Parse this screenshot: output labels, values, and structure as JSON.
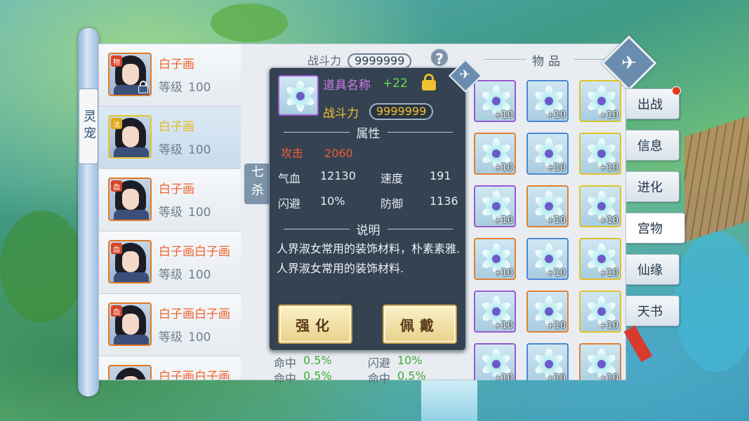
{
  "side_label": "灵宠",
  "pets": [
    {
      "type": "物",
      "name": "白子画",
      "level_label": "等级",
      "level": "100",
      "locked": true,
      "selected": false,
      "gold": false
    },
    {
      "type": "法",
      "name": "白子画",
      "level_label": "等级",
      "level": "100",
      "locked": false,
      "selected": true,
      "gold": true
    },
    {
      "type": "血",
      "name": "白子画",
      "level_label": "等级",
      "level": "100",
      "locked": false,
      "selected": false,
      "gold": false
    },
    {
      "type": "血",
      "name": "白子画白子画",
      "level_label": "等级",
      "level": "100",
      "locked": false,
      "selected": false,
      "gold": false
    },
    {
      "type": "血",
      "name": "白子画白子画",
      "level_label": "等级",
      "level": "100",
      "locked": false,
      "selected": false,
      "gold": false
    },
    {
      "type": "",
      "name": "白子画白子画",
      "level_label": "",
      "level": "",
      "locked": false,
      "selected": false,
      "gold": false
    }
  ],
  "middle": {
    "power_label": "战斗力",
    "power_value": "9999999",
    "help": "?",
    "tag_text": [
      "七",
      "杀"
    ],
    "attr_title": "属性",
    "bottom_stats": [
      {
        "k1": "命中",
        "v1": "0.5%",
        "k2": "闪避",
        "v2": "10%"
      },
      {
        "k1": "命中",
        "v1": "0.5%",
        "k2": "命中",
        "v2": "0.5%"
      }
    ]
  },
  "items": {
    "title": "物品",
    "plus": "+10",
    "borders": [
      "purple",
      "blue",
      "gold",
      "orange",
      "blue",
      "gold",
      "purple",
      "orange",
      "gold",
      "orange",
      "blue",
      "gold",
      "purple",
      "orange",
      "gold",
      "purple",
      "blue",
      "orange"
    ]
  },
  "side_tabs": [
    {
      "label": "出战",
      "badge": true,
      "active": false
    },
    {
      "label": "信息",
      "badge": false,
      "active": false
    },
    {
      "label": "进化",
      "badge": false,
      "active": false
    },
    {
      "label": "宫物",
      "badge": false,
      "active": true
    },
    {
      "label": "仙缘",
      "badge": false,
      "active": false
    },
    {
      "label": "天书",
      "badge": false,
      "active": false
    }
  ],
  "tooltip": {
    "item_name": "道具名称",
    "plus": "+22",
    "power_label": "战斗力",
    "power_value": "9999999",
    "attr_section": "属性",
    "attack_label": "攻击",
    "attack_value": "2060",
    "stats": {
      "hp_label": "气血",
      "hp_value": "12130",
      "speed_label": "速度",
      "speed_value": "191",
      "dodge_label": "闪避",
      "dodge_value": "10%",
      "def_label": "防御",
      "def_value": "1136"
    },
    "desc_section": "说明",
    "description": "人界淑女常用的装饰材料，朴素素雅.人界淑女常用的装饰材料.",
    "btn_enhance": "强化",
    "btn_wear": "佩戴"
  },
  "colors": {
    "purple": "#9a5ad0",
    "blue": "#4d87d2",
    "orange": "#e08032",
    "gold": "#e0c22a",
    "name_orange": "#f0612b",
    "name_gold": "#e6b81a"
  }
}
